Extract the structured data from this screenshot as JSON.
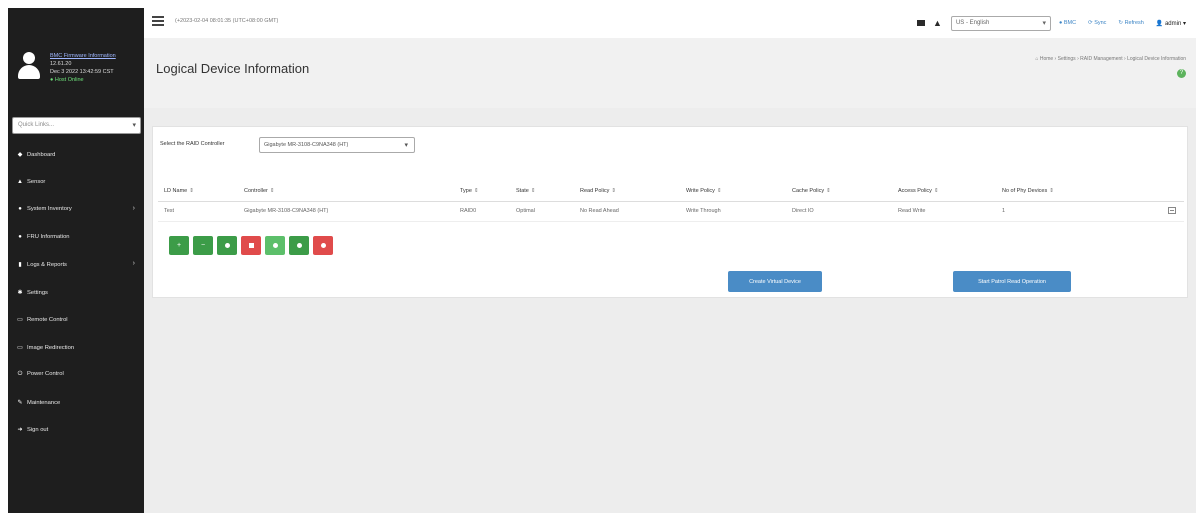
{
  "sidebar": {
    "user": {
      "fw_link": "BMC Firmware Information",
      "version": "12.61.20",
      "build_date": "Dec 3 2022 13:42:59 CST",
      "status": "Host Online"
    },
    "quick_links_placeholder": "Quick Links...",
    "items": [
      {
        "label": "Dashboard",
        "icon": "dashboard-icon",
        "glyph": "◆",
        "has_arrow": false
      },
      {
        "label": "Sensor",
        "icon": "sensor-icon",
        "glyph": "▲",
        "has_arrow": false
      },
      {
        "label": "System Inventory",
        "icon": "inventory-icon",
        "glyph": "●",
        "has_arrow": true
      },
      {
        "label": "FRU Information",
        "icon": "fru-icon",
        "glyph": "●",
        "has_arrow": false
      },
      {
        "label": "Logs & Reports",
        "icon": "logs-icon",
        "glyph": "▮",
        "has_arrow": true
      },
      {
        "label": "Settings",
        "icon": "gear-icon",
        "glyph": "✱",
        "has_arrow": false
      },
      {
        "label": "Remote Control",
        "icon": "monitor-icon",
        "glyph": "▭",
        "has_arrow": false
      },
      {
        "label": "Image Redirection",
        "icon": "image-icon",
        "glyph": "▭",
        "has_arrow": false
      },
      {
        "label": "Power Control",
        "icon": "power-icon",
        "glyph": "⏻",
        "has_arrow": false
      },
      {
        "label": "Maintenance",
        "icon": "wrench-icon",
        "glyph": "✎",
        "has_arrow": false
      },
      {
        "label": "Sign out",
        "icon": "signout-icon",
        "glyph": "➜",
        "has_arrow": false
      }
    ]
  },
  "topbar": {
    "datetime": "(+2023-02-04 08:01:35 (UTC+08:00 GMT)",
    "language": "US - English",
    "sync_label": "Sync",
    "refresh_label": "Refresh",
    "user_label": "admin",
    "host_label": "BMC"
  },
  "header": {
    "title": "Logical Device Information",
    "breadcrumb": "Home  ›  Settings  ›  RAID Management  ›  Logical Device Information"
  },
  "panel": {
    "controller_label": "Select the RAID Controller",
    "controller_value": "Gigabyte MR-3108-C9NA348 (HT)",
    "columns": [
      "LD Name",
      "Controller",
      "Type",
      "State",
      "Read Policy",
      "Write Policy",
      "Cache Policy",
      "Access Policy",
      "No of Phy Devices"
    ],
    "rows": [
      [
        "Test",
        "Gigabyte MR-3108-C9NA348 (HT)",
        "RAID0",
        "Optimal",
        "No Read Ahead",
        "Write Through",
        "Direct IO",
        "Read Write",
        "1"
      ]
    ],
    "action_buttons": [
      {
        "name": "add-button",
        "color": "#3c9c48",
        "glyph": "+"
      },
      {
        "name": "remove-button",
        "color": "#3c9c48",
        "glyph": "−"
      },
      {
        "name": "action-button-3",
        "color": "#3c9c48",
        "glyph": "dot"
      },
      {
        "name": "action-button-4",
        "color": "#e04b4b",
        "glyph": "square"
      },
      {
        "name": "action-button-5",
        "color": "#5cbf6a",
        "glyph": "dot"
      },
      {
        "name": "action-button-6",
        "color": "#3c9c48",
        "glyph": "dot"
      },
      {
        "name": "action-button-7",
        "color": "#e04b4b",
        "glyph": "dot"
      }
    ],
    "create_button": "Create Virtual Device",
    "patrol_button": "Start Patrol Read Operation"
  },
  "colors": {
    "sidebar_bg": "#1e1e1e",
    "accent_blue": "#4a8cc6",
    "green": "#3c9c48",
    "red": "#e04b4b"
  }
}
